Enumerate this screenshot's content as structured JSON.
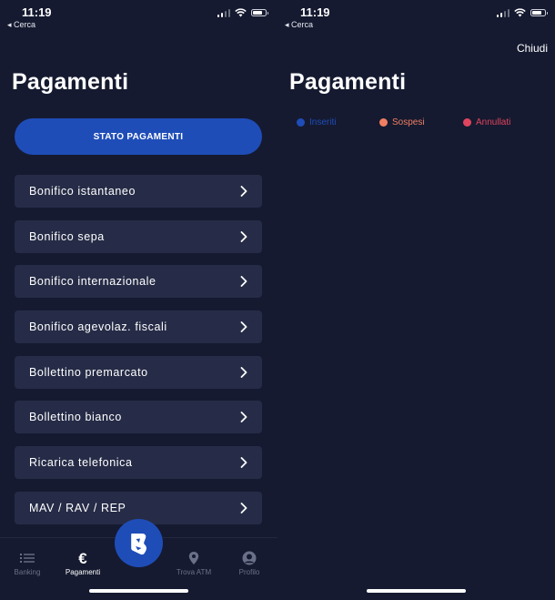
{
  "colors": {
    "background": "#151a30",
    "card": "#262c47",
    "accent": "#1f4db8",
    "inseriti": "#1f4db8",
    "sospesi": "#f07f62",
    "annullati": "#e0445e"
  },
  "left_screen": {
    "status_bar": {
      "time": "11:19",
      "back_label": "◂ Cerca"
    },
    "title": "Pagamenti",
    "primary_button": "STATO PAGAMENTI",
    "menu_items": [
      {
        "label": "Bonifico istantaneo",
        "icon": "chevron-right-icon"
      },
      {
        "label": "Bonifico sepa",
        "icon": "chevron-right-icon"
      },
      {
        "label": "Bonifico internazionale",
        "icon": "chevron-right-icon"
      },
      {
        "label": "Bonifico agevolaz. fiscali",
        "icon": "chevron-right-icon"
      },
      {
        "label": "Bollettino premarcato",
        "icon": "chevron-right-icon"
      },
      {
        "label": "Bollettino bianco",
        "icon": "chevron-right-icon"
      },
      {
        "label": "Ricarica telefonica",
        "icon": "chevron-right-icon"
      },
      {
        "label": "MAV / RAV / REP",
        "icon": "chevron-right-icon"
      }
    ],
    "tabbar": {
      "tabs": [
        {
          "label": "Banking",
          "icon": "list-icon",
          "active": false
        },
        {
          "label": "Pagamenti",
          "icon": "euro-icon",
          "active": true
        },
        {
          "label": "Trova ATM",
          "icon": "map-pin-icon",
          "active": false
        },
        {
          "label": "Profilo",
          "icon": "user-icon",
          "active": false
        }
      ],
      "center_button_icon": "bank-logo-icon"
    }
  },
  "right_screen": {
    "status_bar": {
      "time": "11:19",
      "back_label": "◂ Cerca"
    },
    "close_label": "Chiudi",
    "title": "Pagamenti",
    "legend": [
      {
        "label": "Inseriti",
        "color": "#1f4db8"
      },
      {
        "label": "Sospesi",
        "color": "#f07f62"
      },
      {
        "label": "Annullati",
        "color": "#e0445e"
      }
    ]
  }
}
